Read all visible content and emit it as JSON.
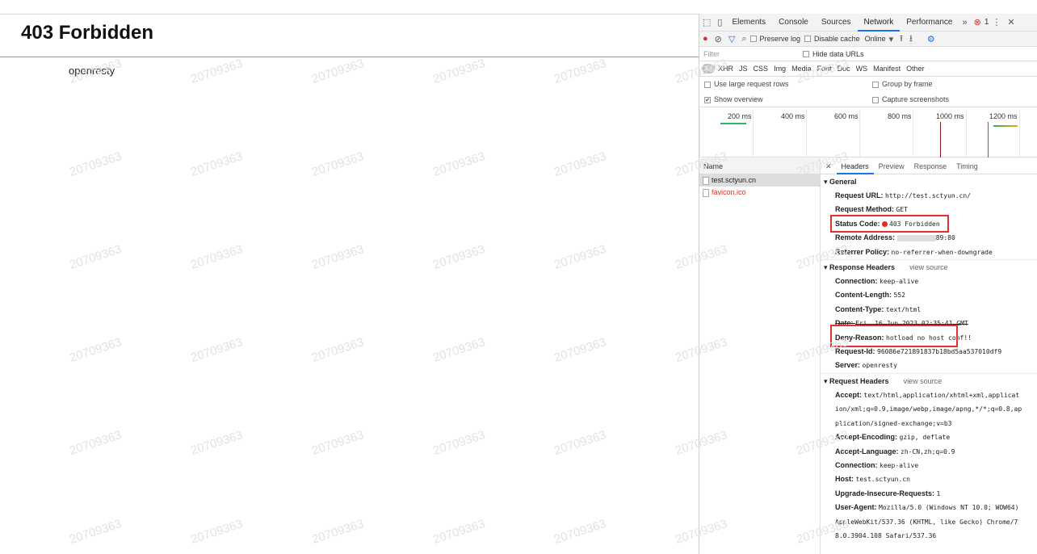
{
  "page": {
    "title": "403 Forbidden",
    "server": "openresty",
    "watermark": "20709363"
  },
  "devtools": {
    "tabs": [
      "Elements",
      "Console",
      "Sources",
      "Network",
      "Performance"
    ],
    "more": "»",
    "error_count": "1",
    "toolbar": {
      "preserve_log": "Preserve log",
      "disable_cache": "Disable cache",
      "throttle": "Online"
    },
    "filter_placeholder": "Filter",
    "hide_data_urls": "Hide data URLs",
    "types": [
      "All",
      "XHR",
      "JS",
      "CSS",
      "Img",
      "Media",
      "Font",
      "Doc",
      "WS",
      "Manifest",
      "Other"
    ],
    "options": {
      "large_rows": "Use large request rows",
      "group_by_frame": "Group by frame",
      "show_overview": "Show overview",
      "capture": "Capture screenshots"
    },
    "timeline_ticks": [
      "200 ms",
      "400 ms",
      "600 ms",
      "800 ms",
      "1000 ms",
      "1200 ms"
    ],
    "name_header": "Name",
    "requests": [
      "test.sctyun.cn",
      "favicon.ico"
    ],
    "detail_tabs": [
      "Headers",
      "Preview",
      "Response",
      "Timing"
    ],
    "general": {
      "title": "General",
      "request_url_k": "Request URL:",
      "request_url_v": "http://test.sctyun.cn/",
      "method_k": "Request Method:",
      "method_v": "GET",
      "status_k": "Status Code:",
      "status_v": "403 Forbidden",
      "remote_k": "Remote Address:",
      "remote_v": "89:80",
      "referrer_k": "Referrer Policy:",
      "referrer_v": "no-referrer-when-downgrade"
    },
    "response_headers": {
      "title": "Response Headers",
      "view_source": "view source",
      "items": [
        {
          "k": "Connection:",
          "v": "keep-alive"
        },
        {
          "k": "Content-Length:",
          "v": "552"
        },
        {
          "k": "Content-Type:",
          "v": "text/html"
        },
        {
          "k": "Date:",
          "v": "Fri, 16 Jun 2023 02:35:41 GMT"
        },
        {
          "k": "Deny-Reason:",
          "v": "hotload no host conf!!"
        },
        {
          "k": "Request-Id:",
          "v": "96086e721891837b18bd5aa537010df9"
        },
        {
          "k": "Server:",
          "v": "openresty"
        }
      ]
    },
    "request_headers": {
      "title": "Request Headers",
      "view_source": "view source",
      "accept_k": "Accept:",
      "accept_v": "text/html,application/xhtml+xml,application/xml;q=0.9,image/webp,image/apng,*/*;q=0.8,application/signed-exchange;v=b3",
      "items": [
        {
          "k": "Accept-Encoding:",
          "v": "gzip, deflate"
        },
        {
          "k": "Accept-Language:",
          "v": "zh-CN,zh;q=0.9"
        },
        {
          "k": "Connection:",
          "v": "keep-alive"
        },
        {
          "k": "Host:",
          "v": "test.sctyun.cn"
        },
        {
          "k": "Upgrade-Insecure-Requests:",
          "v": "1"
        }
      ],
      "ua_k": "User-Agent:",
      "ua_v": "Mozilla/5.0 (Windows NT 10.0; WOW64) AppleWebKit/537.36 (KHTML, like Gecko) Chrome/78.0.3904.108 Safari/537.36"
    }
  }
}
